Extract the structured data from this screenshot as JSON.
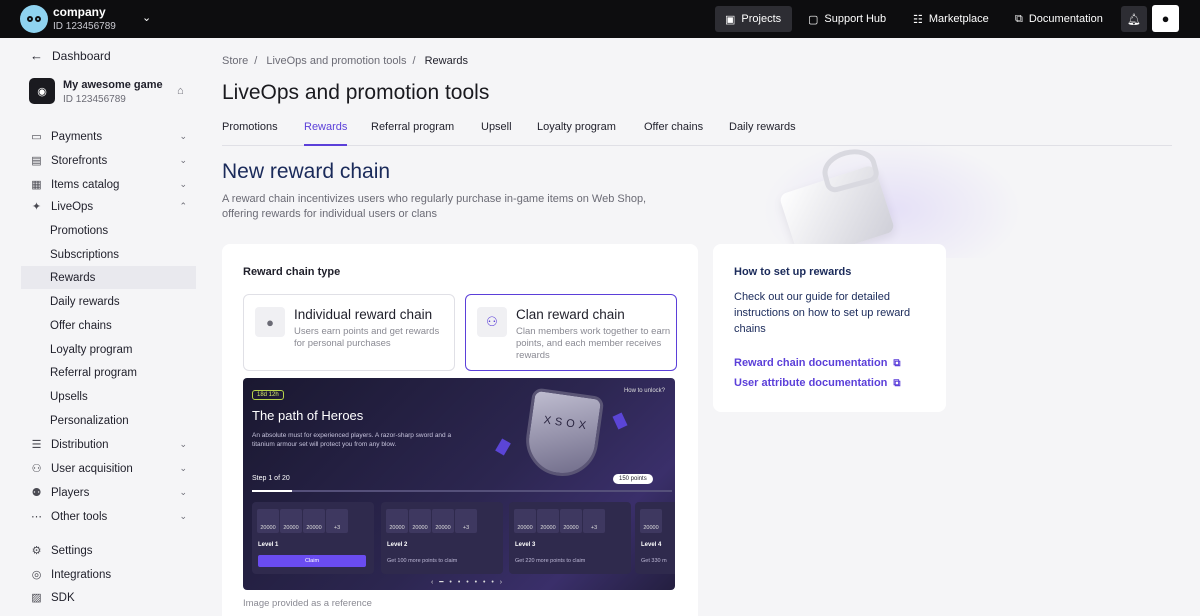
{
  "topbar": {
    "company_name": "company",
    "company_id": "ID 123456789",
    "projects": "Projects",
    "support_hub": "Support Hub",
    "marketplace": "Marketplace",
    "documentation": "Documentation"
  },
  "sidebar": {
    "back": "Dashboard",
    "game_name": "My awesome game",
    "game_id": "ID 123456789",
    "items": {
      "payments": "Payments",
      "storefronts": "Storefronts",
      "items_catalog": "Items catalog",
      "liveops": "LiveOps",
      "promotions": "Promotions",
      "subscriptions": "Subscriptions",
      "rewards": "Rewards",
      "daily_rewards": "Daily rewards",
      "offer_chains": "Offer chains",
      "loyalty_program": "Loyalty program",
      "referral_program": "Referral program",
      "upsells": "Upsells",
      "personalization": "Personalization",
      "distribution": "Distribution",
      "user_acquisition": "User acquisition",
      "players": "Players",
      "other_tools": "Other tools",
      "settings": "Settings",
      "integrations": "Integrations",
      "sdk": "SDK"
    },
    "active": "Rewards"
  },
  "breadcrumb": [
    "Store",
    "LiveOps and promotion tools",
    "Rewards"
  ],
  "page_title": "LiveOps and promotion tools",
  "tabs": [
    "Promotions",
    "Rewards",
    "Referral program",
    "Upsell",
    "Loyalty program",
    "Offer chains",
    "Daily rewards"
  ],
  "active_tab": "Rewards",
  "section": {
    "title": "New reward chain",
    "subtitle": "A reward chain incentivizes users who regularly purchase in-game items on Web Shop, offering rewards for individual users or clans"
  },
  "reward_type": {
    "heading": "Reward chain type",
    "individual_title": "Individual reward chain",
    "individual_desc": "Users earn points and get rewards for personal purchases",
    "clan_title": "Clan reward chain",
    "clan_desc": "Clan members work together to earn points, and each member receives rewards",
    "selected": "Clan reward chain"
  },
  "preview": {
    "badge": "18d 12h",
    "how_to_unlock": "How to unlock?",
    "title": "The path of Heroes",
    "desc": "An absolute must for experienced players. A razor-sharp sword and a titanium armour set will protect you from any blow.",
    "step": "Step 1 of 20",
    "points": "150 points",
    "item_value": "20000",
    "more": "+3",
    "levels": [
      {
        "name": "Level 1",
        "action": "Claim"
      },
      {
        "name": "Level 2",
        "action": "Get 100 more points to claim"
      },
      {
        "name": "Level 3",
        "action": "Get 220 more points to claim"
      },
      {
        "name": "Level 4",
        "action": "Get 330 m"
      }
    ],
    "caption": "Image provided as a reference"
  },
  "help": {
    "title": "How to set up rewards",
    "desc": "Check out our guide for detailed instructions on how to set up reward chains",
    "link1": "Reward chain documentation",
    "link2": "User attribute documentation"
  },
  "colors": {
    "accent": "#5b3fd9",
    "topbar": "#0d0d0f"
  }
}
